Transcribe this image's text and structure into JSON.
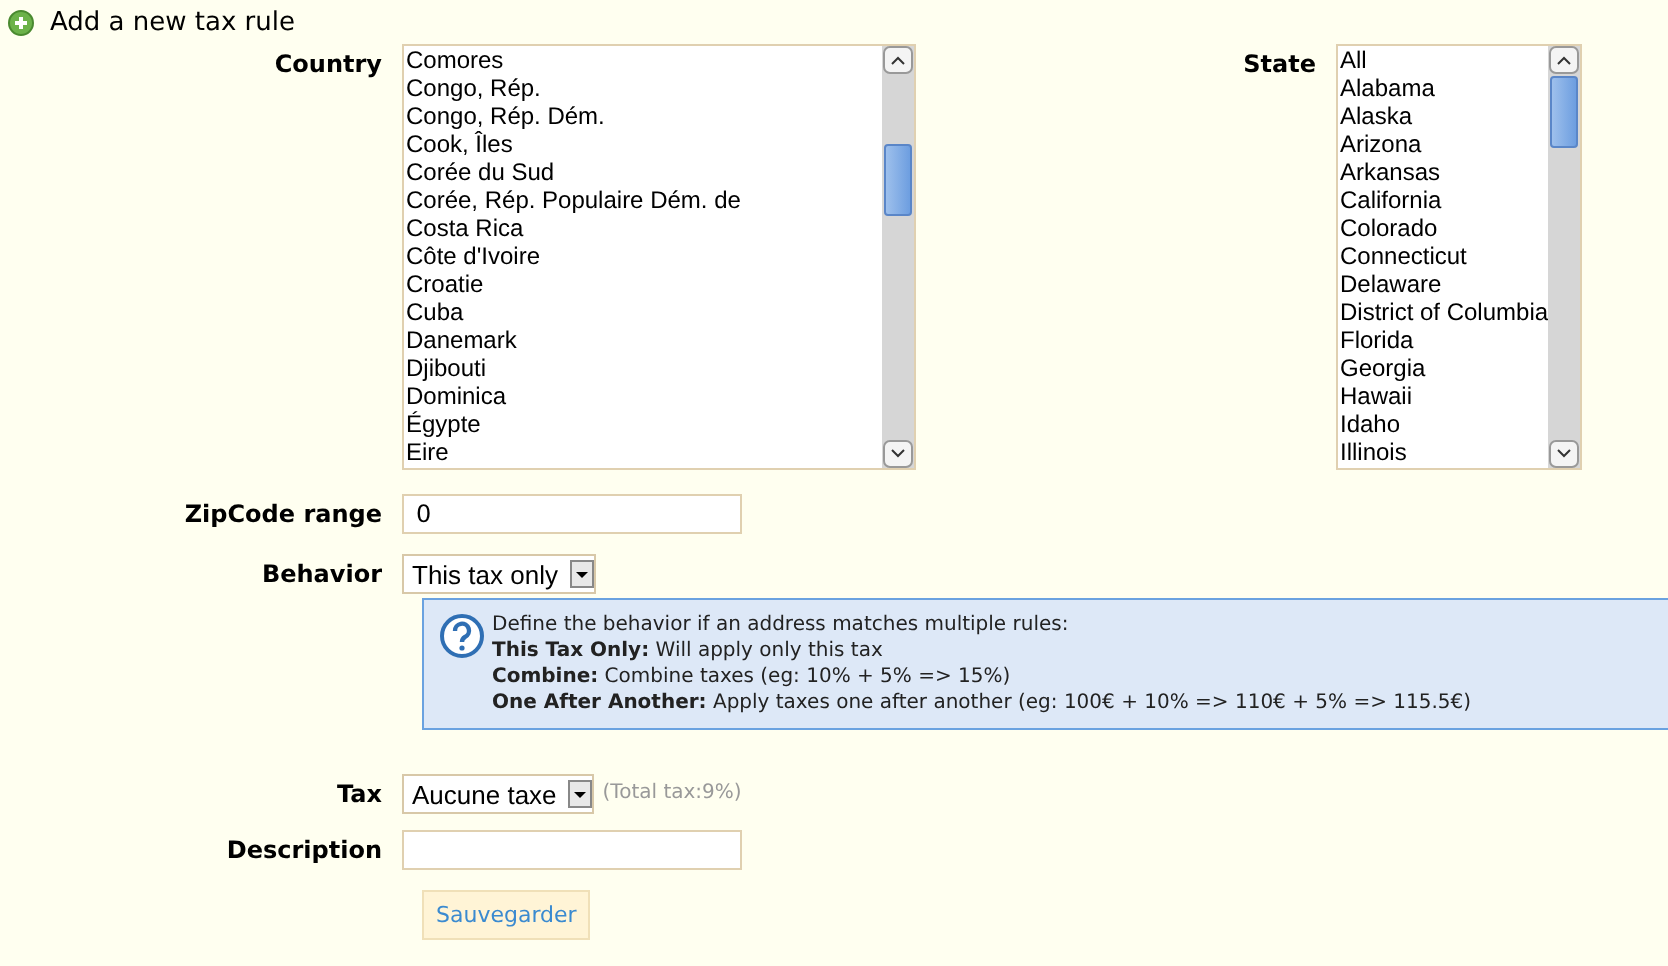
{
  "heading": "Add a new tax rule",
  "country": {
    "label": "Country",
    "options": [
      "Comores",
      "Congo, Rép.",
      "Congo, Rép. Dém.",
      "Cook, Îles",
      "Corée du Sud",
      "Corée, Rép. Populaire Dém. de",
      "Costa Rica",
      "Côte d'Ivoire",
      "Croatie",
      "Cuba",
      "Danemark",
      "Djibouti",
      "Dominica",
      "Égypte",
      "Eire"
    ]
  },
  "state": {
    "label": "State",
    "options": [
      "All",
      "Alabama",
      "Alaska",
      "Arizona",
      "Arkansas",
      "California",
      "Colorado",
      "Connecticut",
      "Delaware",
      "District of Columbia",
      "Florida",
      "Georgia",
      "Hawaii",
      "Idaho",
      "Illinois"
    ]
  },
  "zipcode": {
    "label": "ZipCode range",
    "value": "0"
  },
  "behavior": {
    "label": "Behavior",
    "value": "This tax only"
  },
  "help": [
    "Define the behavior if an address matches multiple rules:",
    "**This Tax Only:** Will apply only this tax",
    "**Combine:** Combine taxes (eg: 10% + 5% => 15%)",
    "**One After Another:** Apply taxes one after another (eg: 100€ + 10% => 110€ + 5% => 115.5€)"
  ],
  "tax": {
    "label": "Tax",
    "value": "Aucune taxe",
    "note": "(Total tax:9%)"
  },
  "description": {
    "label": "Description"
  },
  "save_button": "Sauvegarder"
}
